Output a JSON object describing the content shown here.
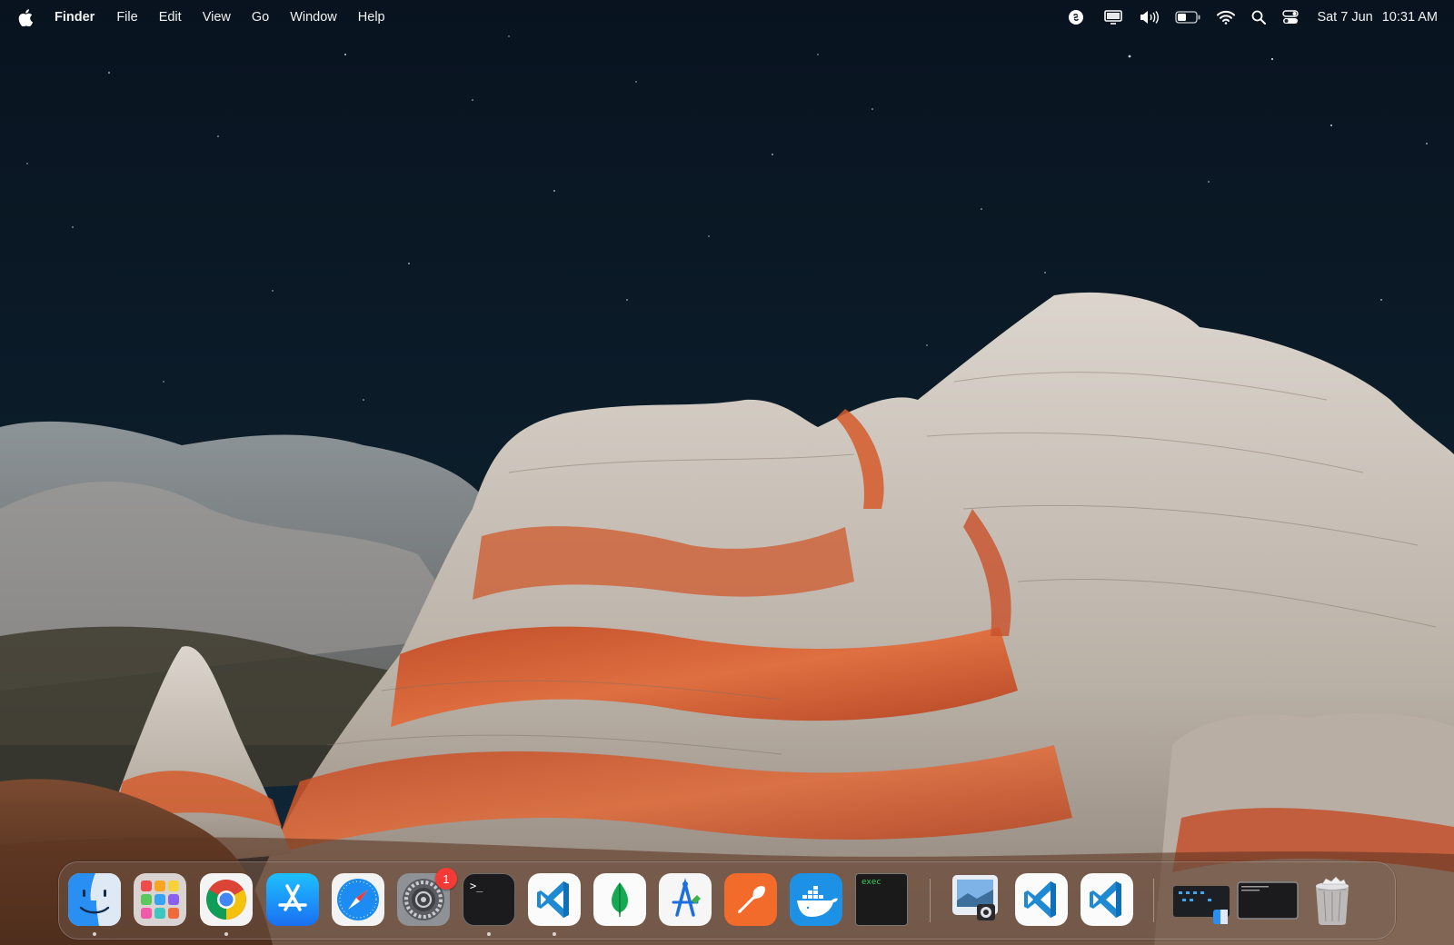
{
  "menubar": {
    "apple_icon": "apple-logo-icon",
    "app_name": "Finder",
    "menus": [
      "File",
      "Edit",
      "View",
      "Go",
      "Window",
      "Help"
    ],
    "status_icons": [
      "shazam-icon",
      "display-icon",
      "volume-icon",
      "battery-icon",
      "wifi-icon",
      "spotlight-search-icon",
      "control-center-icon"
    ],
    "clock": {
      "date": "Sat 7 Jun",
      "time": "10:31 AM"
    }
  },
  "dock": {
    "apps": [
      {
        "name": "Finder",
        "icon": "finder-icon",
        "running": true
      },
      {
        "name": "Launchpad",
        "icon": "launchpad-icon",
        "running": false
      },
      {
        "name": "Google Chrome",
        "icon": "chrome-icon",
        "running": true
      },
      {
        "name": "App Store",
        "icon": "app-store-icon",
        "running": false
      },
      {
        "name": "Safari",
        "icon": "safari-icon",
        "running": false
      },
      {
        "name": "System Settings",
        "icon": "system-settings-icon",
        "running": false,
        "badge": "1"
      },
      {
        "name": "Terminal",
        "icon": "terminal-icon",
        "running": true,
        "text": ">_"
      },
      {
        "name": "Visual Studio Code",
        "icon": "vscode-icon",
        "running": true
      },
      {
        "name": "MongoDB Compass",
        "icon": "mongodb-icon",
        "running": false
      },
      {
        "name": "Instruments",
        "icon": "instruments-icon",
        "running": false
      },
      {
        "name": "Postman",
        "icon": "postman-icon",
        "running": false
      },
      {
        "name": "Docker",
        "icon": "docker-icon",
        "running": false
      },
      {
        "name": "exec",
        "icon": "exec-terminal-icon",
        "running": false,
        "text": "exec"
      }
    ],
    "recent_apps": [
      {
        "name": "Preview",
        "icon": "preview-icon"
      },
      {
        "name": "Visual Studio Code",
        "icon": "vscode-icon"
      },
      {
        "name": "Visual Studio Code",
        "icon": "vscode-icon"
      }
    ],
    "minimized": [
      {
        "name": "Finder window",
        "icon": "minimized-window-finder"
      },
      {
        "name": "Terminal window",
        "icon": "minimized-window-terminal"
      }
    ],
    "trash": {
      "name": "Trash",
      "icon": "trash-full-icon"
    }
  },
  "colors": {
    "sky": "#0a1622",
    "rock_orange": "#d4562a",
    "rock_white": "#cfc6bd",
    "badge_red": "#f43a36"
  }
}
